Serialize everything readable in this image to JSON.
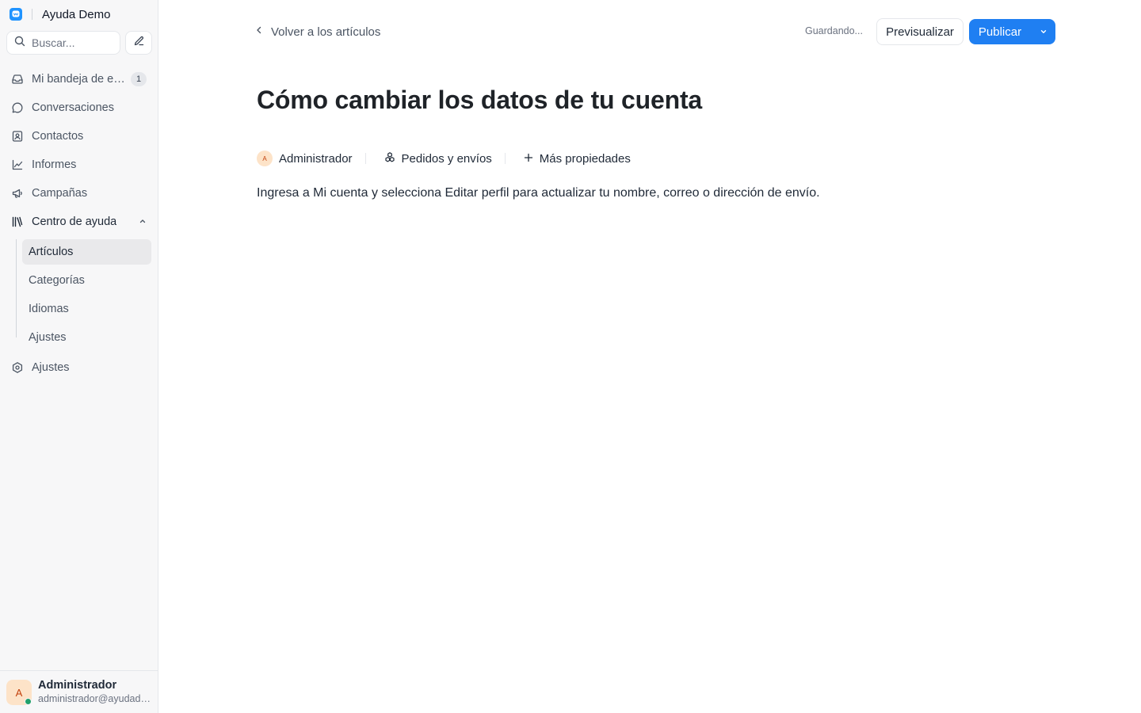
{
  "sidebar": {
    "brand_name": "Ayuda Demo",
    "search_placeholder": "Buscar...",
    "items": [
      {
        "label": "Mi bandeja de entrada",
        "badge": "1",
        "icon": "inbox-icon"
      },
      {
        "label": "Conversaciones",
        "icon": "chat-bubble-icon"
      },
      {
        "label": "Contactos",
        "icon": "contact-card-icon"
      },
      {
        "label": "Informes",
        "icon": "line-chart-icon"
      },
      {
        "label": "Campañas",
        "icon": "megaphone-icon"
      },
      {
        "label": "Centro de ayuda",
        "icon": "library-books-icon"
      },
      {
        "label": "Ajustes",
        "icon": "settings-icon"
      }
    ],
    "help_center_sub": [
      {
        "label": "Artículos",
        "active": true
      },
      {
        "label": "Categorías"
      },
      {
        "label": "Idiomas"
      },
      {
        "label": "Ajustes"
      }
    ],
    "user": {
      "initial": "A",
      "name": "Administrador",
      "email": "administrador@ayudademo.com",
      "status_color": "#22a06b"
    }
  },
  "header": {
    "back_label": "Volver a los artículos",
    "saving_status": "Guardando...",
    "preview_label": "Previsualizar",
    "publish_label": "Publicar"
  },
  "article": {
    "title": "Cómo cambiar los datos de tu cuenta",
    "author_initial": "A",
    "author": "Administrador",
    "category": "Pedidos y envíos",
    "more_properties": "Más propiedades",
    "body": "Ingresa a Mi cuenta y selecciona Editar perfil para actualizar tu nombre, correo o dirección de envío."
  },
  "colors": {
    "accent": "#1f7ff2",
    "sidebar_bg": "#f7f7f8",
    "active_item_bg": "#e9e9eb"
  }
}
